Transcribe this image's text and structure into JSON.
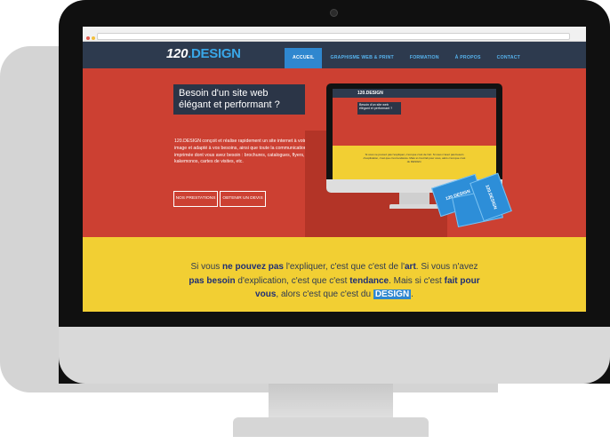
{
  "browser": {
    "dots": [
      "#e05a4f",
      "#f2bf3c",
      "#5bbf59"
    ]
  },
  "site": {
    "logo_prefix": "120",
    "logo_suffix": ".DESIGN",
    "nav": [
      {
        "label": "ACCUEIL",
        "active": true
      },
      {
        "label": "GRAPHISME WEB & PRINT",
        "active": false
      },
      {
        "label": "FORMATION",
        "active": false
      },
      {
        "label": "À PROPOS",
        "active": false
      },
      {
        "label": "CONTACT",
        "active": false
      }
    ]
  },
  "hero": {
    "title": "Besoin d'un site web élégant et performant ?",
    "text": "120.DESIGN conçoit et réalise rapidement un site internet à votre image et adapté à vos besoins, ainsi que toute la communication imprimée dont vous avez besoin : brochures, catalogues, flyers, kakemonos, cartes de visites, etc.",
    "button_prestations": "NOS PRESTATIONS",
    "button_devis": "OBTENIR UN DEVIS"
  },
  "mockup": {
    "logo": "120.DESIGN",
    "title": "Besoin d'un site web élégant et performant ?",
    "tagline": "Si vous ne pouvez pas l'expliquer, c'est que c'est de l'art. Si vous n'avez pas besoin d'explication, c'est que c'est tendance. Mais si c'est fait pour vous, alors c'est que c'est du DESIGN.",
    "card_label": "120.DESIGN"
  },
  "tagline": {
    "p1": "Si vous ",
    "b1": "ne pouvez pas",
    "p2": " l'expliquer, c'est que c'est de l'",
    "b2": "art",
    "p3": ". Si vous n'avez ",
    "b3": "pas besoin",
    "p4": " d'explication, c'est que c'est ",
    "b4": "tendance",
    "p5": ". Mais si c'est ",
    "b5": "fait pour vous",
    "p6": ", alors c'est que c'est du ",
    "tag": "DESIGN",
    "p7": "."
  },
  "colors": {
    "hero_red": "#cc4032",
    "navy": "#2d3a4e",
    "accent_blue": "#2f87cf",
    "yellow": "#f2cf33"
  }
}
